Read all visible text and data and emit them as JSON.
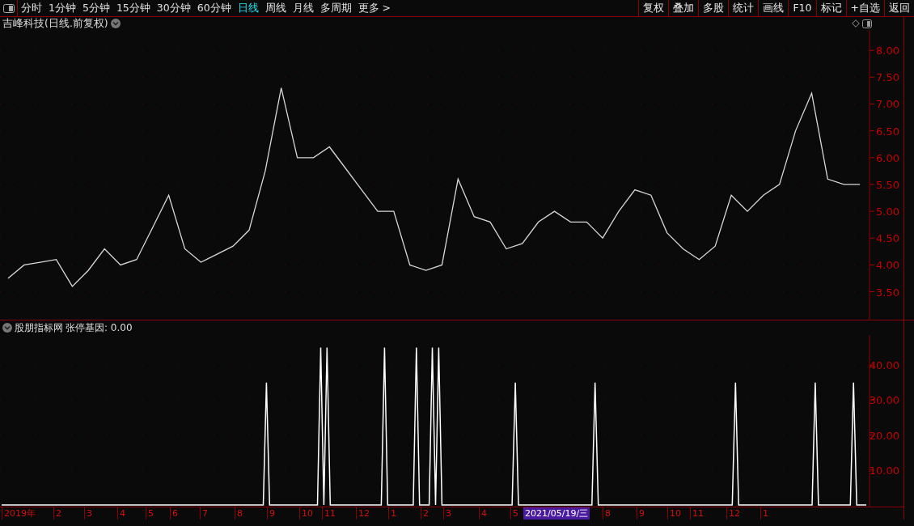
{
  "toolbar": {
    "periods": [
      {
        "label": "分时",
        "selected": false
      },
      {
        "label": "1分钟",
        "selected": false
      },
      {
        "label": "5分钟",
        "selected": false
      },
      {
        "label": "15分钟",
        "selected": false
      },
      {
        "label": "30分钟",
        "selected": false
      },
      {
        "label": "60分钟",
        "selected": false
      },
      {
        "label": "日线",
        "selected": true
      },
      {
        "label": "周线",
        "selected": false
      },
      {
        "label": "月线",
        "selected": false
      },
      {
        "label": "多周期",
        "selected": false
      },
      {
        "label": "更多 >",
        "selected": false
      }
    ],
    "buttons": [
      "复权",
      "叠加",
      "多股",
      "统计",
      "画线",
      "F10",
      "标记",
      "+自选",
      "返回"
    ]
  },
  "price_panel": {
    "title": "吉峰科技(日线.前复权)",
    "chart_data": {
      "type": "line",
      "categories": [
        null,
        null,
        null,
        null,
        null,
        null,
        null,
        null,
        null,
        null,
        null,
        null,
        null,
        null,
        null,
        null,
        null,
        null,
        null,
        null,
        null,
        null,
        null,
        null,
        null,
        null,
        null,
        null,
        null,
        null,
        null,
        null,
        null,
        null,
        null,
        null,
        null,
        null,
        null,
        null,
        null,
        null,
        null,
        null,
        null,
        null,
        null,
        null,
        null,
        null,
        null,
        null,
        null,
        null
      ],
      "ylim": [
        2.98,
        8.38
      ],
      "grid": true,
      "yticks": [
        {
          "value": 3.5,
          "label": "3.50"
        },
        {
          "value": 4,
          "label": "4.00"
        },
        {
          "value": 4.5,
          "label": "4.50"
        },
        {
          "value": 5,
          "label": "5.00"
        },
        {
          "value": 5.5,
          "label": "5.50"
        },
        {
          "value": 6,
          "label": "6.00"
        },
        {
          "value": 6.5,
          "label": "6.50"
        },
        {
          "value": 7,
          "label": "7.00"
        },
        {
          "value": 7.5,
          "label": "7.50"
        },
        {
          "value": 8,
          "label": "8.00"
        }
      ],
      "series": [
        {
          "color": "#d8d8d8",
          "values": [
            3.75,
            4.0,
            4.05,
            4.1,
            3.6,
            3.9,
            4.3,
            4.0,
            4.1,
            4.7,
            5.3,
            4.3,
            4.05,
            4.2,
            4.35,
            4.65,
            5.75,
            7.3,
            6.0,
            6.0,
            6.2,
            5.8,
            5.4,
            5.0,
            5.0,
            4.0,
            3.9,
            4.0,
            5.6,
            4.9,
            4.8,
            4.3,
            4.4,
            4.8,
            5.0,
            4.8,
            4.8,
            4.5,
            5.0,
            5.4,
            5.3,
            4.6,
            4.3,
            4.1,
            4.35,
            5.3,
            5.0,
            5.3,
            5.5,
            6.5,
            7.2,
            5.6,
            5.5,
            5.5
          ]
        }
      ]
    }
  },
  "indicator_panel": {
    "name": "股朋指标网",
    "reading": "张停基因: 0.00",
    "chart_data": {
      "type": "line",
      "categories": [
        null,
        null,
        null,
        null,
        null,
        null,
        null,
        null,
        null,
        null,
        null,
        null,
        null,
        null,
        null,
        null,
        null,
        null,
        null,
        null,
        null,
        null,
        null,
        null,
        null,
        null,
        null,
        null,
        null,
        null,
        null,
        null,
        null,
        null,
        null,
        null,
        null,
        null,
        null,
        null,
        null,
        null,
        null,
        null,
        null,
        null,
        null,
        null,
        null,
        null,
        null,
        null,
        null,
        null,
        null,
        null,
        null,
        null,
        null,
        null,
        null,
        null,
        null,
        null,
        null,
        null,
        null,
        null,
        null,
        null,
        null,
        null,
        null,
        null,
        null,
        null,
        null,
        null,
        null,
        null,
        null,
        null,
        null,
        null,
        null,
        null,
        null,
        null,
        null,
        null,
        null,
        null,
        null,
        null,
        null,
        null,
        null,
        null,
        null,
        null,
        null,
        null,
        null,
        null,
        null,
        null,
        null,
        null,
        null,
        null,
        null,
        null,
        null,
        null,
        null,
        null,
        null,
        null,
        null,
        null,
        null,
        null,
        null,
        null,
        null,
        null,
        null,
        null,
        null,
        null,
        null,
        null,
        null,
        null,
        null,
        null,
        null,
        null,
        null,
        null,
        null,
        null,
        null,
        null,
        null,
        null,
        null,
        null,
        null,
        null,
        null,
        null,
        null,
        null,
        null,
        null,
        null,
        null,
        null,
        null,
        null,
        null,
        null,
        null,
        null,
        null,
        null,
        null,
        null,
        null,
        null,
        null,
        null,
        null,
        null,
        null,
        null,
        null,
        null,
        null,
        null,
        null,
        null,
        null,
        null,
        null,
        null,
        null,
        null,
        null,
        null,
        null,
        null,
        null,
        null,
        null,
        null,
        null,
        null,
        null,
        null,
        null,
        null,
        null,
        null,
        null,
        null,
        null,
        null,
        null,
        null,
        null,
        null,
        null,
        null,
        null,
        null,
        null,
        null,
        null,
        null,
        null,
        null,
        null,
        null,
        null,
        null,
        null,
        null,
        null,
        null,
        null,
        null,
        null,
        null,
        null,
        null,
        null,
        null,
        null,
        null,
        null,
        null,
        null,
        null,
        null,
        null,
        null,
        null,
        null,
        null,
        null,
        null,
        null,
        null,
        null,
        null,
        null,
        null,
        null,
        null,
        null,
        null,
        null,
        null,
        null,
        null,
        null,
        null,
        null,
        null,
        null
      ],
      "ylim": [
        0,
        48.6
      ],
      "grid": true,
      "yticks": [
        {
          "value": 10,
          "label": "10.00"
        },
        {
          "value": 20,
          "label": "20.00"
        },
        {
          "value": 30,
          "label": "30.00"
        },
        {
          "value": 40,
          "label": "40.00"
        }
      ],
      "series": [
        {
          "color": "#ffffff",
          "values": [
            0,
            0,
            0,
            0,
            0,
            0,
            0,
            0,
            0,
            0,
            0,
            0,
            0,
            0,
            0,
            0,
            0,
            0,
            0,
            0,
            0,
            0,
            0,
            0,
            0,
            0,
            0,
            0,
            0,
            0,
            0,
            0,
            0,
            0,
            0,
            0,
            0,
            0,
            0,
            0,
            0,
            0,
            0,
            0,
            0,
            0,
            0,
            0,
            0,
            0,
            0,
            0,
            0,
            0,
            0,
            0,
            0,
            0,
            0,
            0,
            0,
            0,
            0,
            0,
            0,
            0,
            0,
            0,
            0,
            0,
            0,
            0,
            0,
            0,
            0,
            0,
            0,
            0,
            0,
            0,
            0,
            0,
            0,
            35,
            0,
            0,
            0,
            0,
            0,
            0,
            0,
            0,
            0,
            0,
            0,
            0,
            0,
            0,
            0,
            0,
            45,
            0,
            45,
            0,
            0,
            0,
            0,
            0,
            0,
            0,
            0,
            0,
            0,
            0,
            0,
            0,
            0,
            0,
            0,
            0,
            45,
            0,
            0,
            0,
            0,
            0,
            0,
            0,
            0,
            0,
            45,
            0,
            0,
            0,
            0,
            45,
            0,
            45,
            0,
            0,
            0,
            0,
            0,
            0,
            0,
            0,
            0,
            0,
            0,
            0,
            0,
            0,
            0,
            0,
            0,
            0,
            0,
            0,
            0,
            0,
            0,
            35,
            0,
            0,
            0,
            0,
            0,
            0,
            0,
            0,
            0,
            0,
            0,
            0,
            0,
            0,
            0,
            0,
            0,
            0,
            0,
            0,
            0,
            0,
            0,
            0,
            35,
            0,
            0,
            0,
            0,
            0,
            0,
            0,
            0,
            0,
            0,
            0,
            0,
            0,
            0,
            0,
            0,
            0,
            0,
            0,
            0,
            0,
            0,
            0,
            0,
            0,
            0,
            0,
            0,
            0,
            0,
            0,
            0,
            0,
            0,
            0,
            0,
            0,
            0,
            0,
            0,
            0,
            0,
            0,
            35,
            0,
            0,
            0,
            0,
            0,
            0,
            0,
            0,
            0,
            0,
            0,
            0,
            0,
            0,
            0,
            0,
            0,
            0,
            0,
            0,
            0,
            0,
            0,
            0,
            35,
            0,
            0,
            0,
            0,
            0,
            0,
            0,
            0,
            0,
            0,
            0,
            35,
            0,
            0,
            0,
            0
          ]
        }
      ]
    }
  },
  "date_axis": {
    "labels": [
      "2019年",
      "2",
      "3",
      "4",
      "5",
      "6",
      "7",
      "8",
      "9",
      "10",
      "11",
      "12",
      "1",
      "2",
      "3",
      "4",
      "5",
      "8",
      "9",
      "10",
      "11",
      "12",
      "1"
    ],
    "cursor_date": "2021/05/19/三"
  }
}
